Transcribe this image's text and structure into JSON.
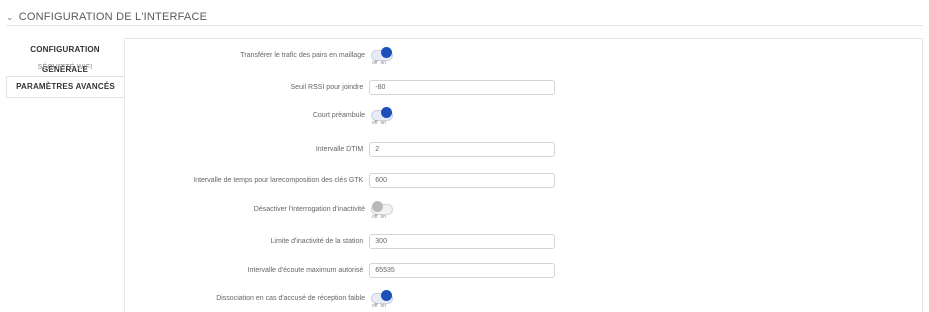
{
  "section": {
    "title": "CONFIGURATION DE L'INTERFACE"
  },
  "sidebar": {
    "items": [
      {
        "label": "CONFIGURATION GÉNÉRALE"
      },
      {
        "label": "SÉCURITÉ WIFI"
      },
      {
        "label": "PARAMÈTRES AVANCÉS"
      }
    ]
  },
  "toggle_text": {
    "off": "off",
    "on": "on"
  },
  "rows": [
    {
      "label": "Transférer le trafic des pairs en maillage",
      "type": "toggle",
      "value": "on"
    },
    {
      "label": "Seuil RSSI pour joindre",
      "type": "input",
      "value": "-80"
    },
    {
      "label": "Court préambule",
      "type": "toggle",
      "value": "on"
    },
    {
      "label": "Intervalle DTIM",
      "type": "input",
      "value": "2"
    },
    {
      "label": "Intervalle de temps pour larecomposition des clés GTK",
      "type": "input",
      "value": "600"
    },
    {
      "label": "Désactiver l'interrogation d'inactivité",
      "type": "toggle",
      "value": "off"
    },
    {
      "label": "Limite d'inactivité de la station",
      "type": "input",
      "value": "300"
    },
    {
      "label": "Intervalle d'écoute maximum autorisé",
      "type": "input",
      "value": "65535"
    },
    {
      "label": "Dissociation en cas d'accusé de réception faible",
      "type": "toggle",
      "value": "on"
    }
  ],
  "colors": {
    "accent": "#1d4fb8",
    "border": "#e6e6e6"
  }
}
